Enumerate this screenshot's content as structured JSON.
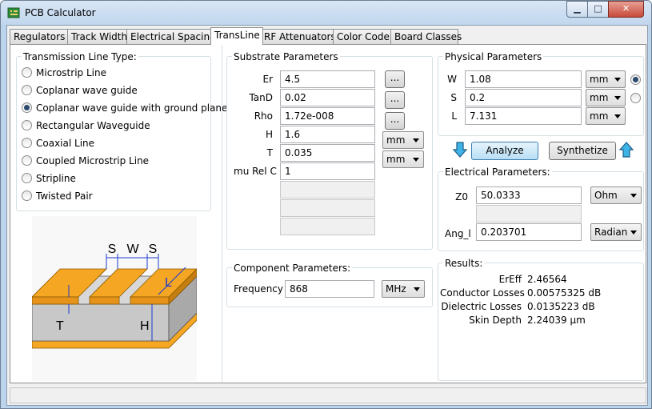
{
  "window": {
    "title": "PCB Calculator"
  },
  "tabs": [
    "Regulators",
    "Track Width",
    "Electrical Spacing",
    "TransLine",
    "RF Attenuators",
    "Color Code",
    "Board Classes"
  ],
  "line_type": {
    "title": "Transmission Line Type:",
    "options": [
      "Microstrip Line",
      "Coplanar wave guide",
      "Coplanar wave guide with ground plane",
      "Rectangular Waveguide",
      "Coaxial Line",
      "Coupled Microstrip Line",
      "Stripline",
      "Twisted Pair"
    ],
    "selected": "Coplanar wave guide with ground plane"
  },
  "diagram": {
    "labels": {
      "s1": "S",
      "w": "W",
      "s2": "S",
      "l": "L",
      "t": "T",
      "h": "H"
    },
    "colors": {
      "copper": "#f5a623",
      "dielectric": "#c8c8c8",
      "dim": "#1a3ad1"
    }
  },
  "substrate": {
    "title": "Substrate Parameters",
    "er_label": "Er",
    "er": "4.5",
    "tand_label": "TanD",
    "tand": "0.02",
    "rho_label": "Rho",
    "rho": "1.72e-008",
    "h_label": "H",
    "h": "1.6",
    "h_unit": "mm",
    "t_label": "T",
    "t": "0.035",
    "t_unit": "mm",
    "murel_label": "mu Rel C",
    "murel": "1",
    "dots": "..."
  },
  "component": {
    "title": "Component Parameters:",
    "freq_label": "Frequency",
    "freq": "868",
    "freq_unit": "MHz"
  },
  "physical": {
    "title": "Physical Parameters",
    "w_label": "W",
    "w": "1.08",
    "w_unit": "mm",
    "s_label": "S",
    "s": "0.2",
    "s_unit": "mm",
    "l_label": "L",
    "l": "7.131",
    "l_unit": "mm"
  },
  "actions": {
    "analyze": "Analyze",
    "synthesize": "Synthetize"
  },
  "electrical": {
    "title": "Electrical Parameters:",
    "z0_label": "Z0",
    "z0": "50.0333",
    "z0_unit": "Ohm",
    "ang_label": "Ang_l",
    "ang": "0.203701",
    "ang_unit": "Radian"
  },
  "results": {
    "title": "Results:",
    "rows": [
      {
        "label": "ErEff",
        "value": "2.46564"
      },
      {
        "label": "Conductor Losses",
        "value": "0.00575325 dB"
      },
      {
        "label": "Dielectric Losses",
        "value": "0.0135223 dB"
      },
      {
        "label": "Skin Depth",
        "value": "2.24039 µm"
      }
    ]
  }
}
